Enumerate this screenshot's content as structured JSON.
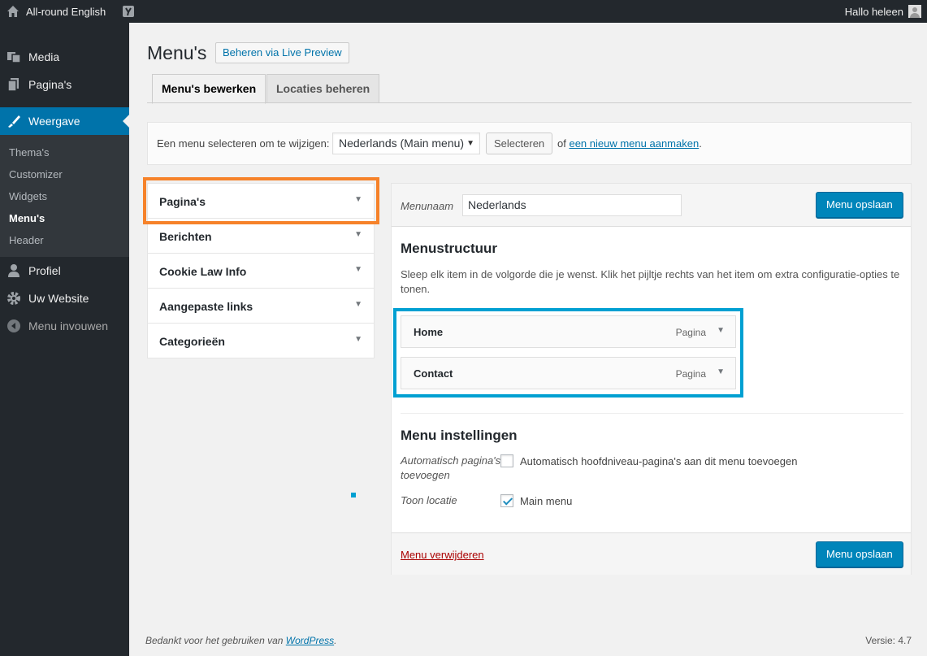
{
  "adminbar": {
    "site_name": "All-round English",
    "greeting": "Hallo heleen"
  },
  "sidebar": {
    "items": [
      {
        "label": "Media",
        "icon": "media-icon"
      },
      {
        "label": "Pagina's",
        "icon": "pages-icon"
      },
      {
        "label": "Weergave",
        "icon": "appearance-icon"
      },
      {
        "label": "Profiel",
        "icon": "profile-icon"
      },
      {
        "label": "Uw Website",
        "icon": "settings-icon"
      },
      {
        "label": "Menu invouwen",
        "icon": "collapse-icon"
      }
    ],
    "submenu": [
      "Thema's",
      "Customizer",
      "Widgets",
      "Menu's",
      "Header"
    ]
  },
  "page": {
    "title": "Menu's",
    "preview_button": "Beheren via Live Preview",
    "tabs": [
      "Menu's bewerken",
      "Locaties beheren"
    ]
  },
  "manage": {
    "label": "Een menu selecteren om te wijzigen:",
    "selected": "Nederlands (Main menu)",
    "select_button": "Selecteren",
    "or": "of",
    "new_link": "een nieuw menu aanmaken",
    "period": "."
  },
  "accordion": [
    "Pagina's",
    "Berichten",
    "Cookie Law Info",
    "Aangepaste links",
    "Categorieën"
  ],
  "editor": {
    "name_label": "Menunaam",
    "name_value": "Nederlands",
    "save_label": "Menu opslaan",
    "structure_title": "Menustructuur",
    "structure_desc": "Sleep elk item in de volgorde die je wenst. Klik het pijltje rechts van het item om extra configuratie-opties te tonen.",
    "items": [
      {
        "title": "Home",
        "type": "Pagina"
      },
      {
        "title": "Contact",
        "type": "Pagina"
      }
    ],
    "settings_title": "Menu instellingen",
    "auto_label": "Automatisch pagina's toevoegen",
    "auto_text": "Automatisch hoofdniveau-pagina's aan dit menu toevoegen",
    "location_label": "Toon locatie",
    "location_text": "Main menu",
    "delete_label": "Menu verwijderen"
  },
  "footer": {
    "thanks": "Bedankt voor het gebruiken van",
    "wp_link": "WordPress",
    "period": ".",
    "version": "Versie: 4.7"
  },
  "colors": {
    "highlight_orange": "#f6822a",
    "highlight_blue": "#00a0d2",
    "primary": "#0085ba",
    "sidebar": "#23282d"
  }
}
